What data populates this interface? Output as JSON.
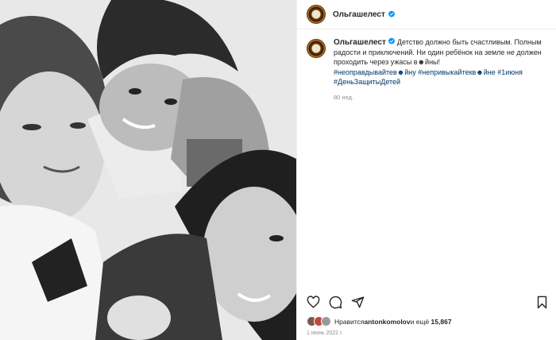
{
  "post": {
    "username": "Ольгашелест",
    "caption_text": "Детство должно быть счастливым. Полным радости и приключений. Ни один ребёнок на земле не должен проходить через ужасы в☻йны!",
    "hashtags": "#неоправдывайтев☻йну #непривыкайтекв☻йне #1июня #ДеньЗащитыДетей",
    "age": "80 нед.",
    "likes_prefix": "Нравится",
    "likes_user": "antonkomolov",
    "likes_middle": " и ещё ",
    "likes_count": "15,867",
    "date": "1 июнь 2022 г."
  },
  "colors": {
    "verified": "#0095f6",
    "hashtag": "#00376b",
    "muted": "#8e8e8e"
  },
  "icons": {
    "like": "heart-icon",
    "comment": "comment-icon",
    "share": "share-icon",
    "save": "bookmark-icon"
  }
}
